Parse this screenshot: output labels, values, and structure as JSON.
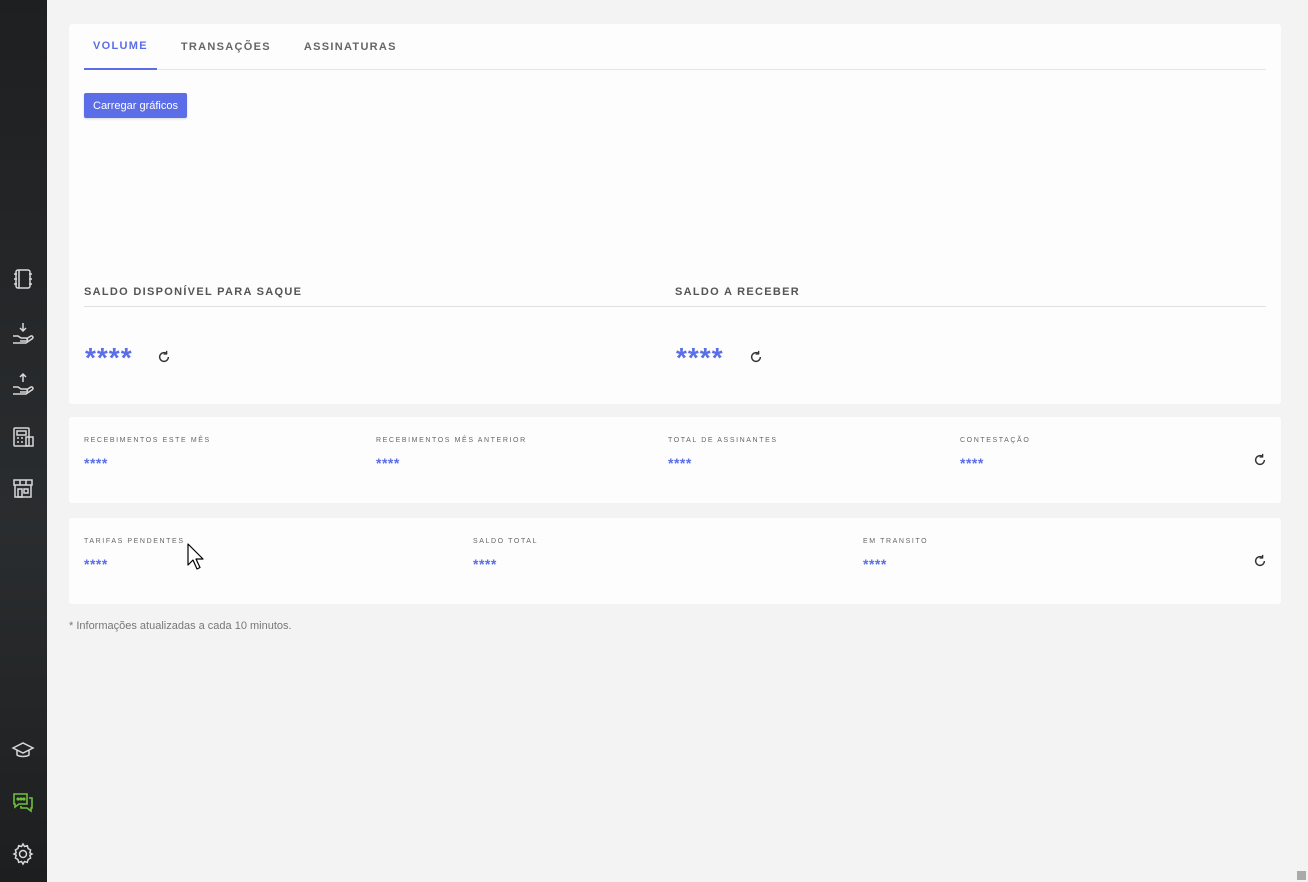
{
  "sidebar": {
    "icons": [
      "notebook-icon",
      "hand-receive-icon",
      "hand-send-icon",
      "calculator-icon",
      "store-icon",
      "graduation-cap-icon",
      "chat-icon",
      "gear-icon"
    ],
    "chat_color": "#6fbf3c"
  },
  "tabs": [
    {
      "label": "VOLUME",
      "active": true
    },
    {
      "label": "TRANSAÇÕES",
      "active": false
    },
    {
      "label": "ASSINATURAS",
      "active": false
    }
  ],
  "load_button": "Carregar gráficos",
  "balances": {
    "available": {
      "label": "SALDO DISPONÍVEL PARA SAQUE",
      "value": "****"
    },
    "receivable": {
      "label": "SALDO A RECEBER",
      "value": "****"
    }
  },
  "stats_row1": [
    {
      "label": "RECEBIMENTOS ESTE MÊS",
      "value": "****"
    },
    {
      "label": "RECEBIMENTOS MÊS ANTERIOR",
      "value": "****"
    },
    {
      "label": "TOTAL DE ASSINANTES",
      "value": "****"
    },
    {
      "label": "CONTESTAÇÃO",
      "value": "****"
    }
  ],
  "stats_row2": [
    {
      "label": "TARIFAS PENDENTES",
      "value": "****"
    },
    {
      "label": "SALDO TOTAL",
      "value": "****"
    },
    {
      "label": "EM TRANSITO",
      "value": "****"
    }
  ],
  "footnote": "* Informações atualizadas a cada 10 minutos.",
  "colors": {
    "accent": "#5b6ee8",
    "sidebar": "#222426"
  }
}
